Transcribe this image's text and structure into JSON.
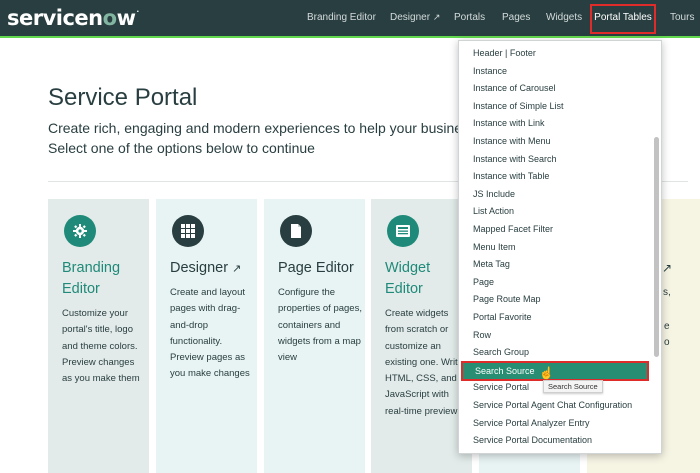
{
  "header": {
    "logo": {
      "text_before": "servicen",
      "o": "o",
      "text_after": "w",
      "tm": "."
    },
    "nav": [
      {
        "label": "Branding Editor"
      },
      {
        "label": "Designer"
      },
      {
        "label": "Portals"
      },
      {
        "label": "Pages"
      },
      {
        "label": "Widgets"
      },
      {
        "label": "Portal Tables"
      },
      {
        "label": "Tours"
      }
    ],
    "external_icon": "↗"
  },
  "hero": {
    "title": "Service Portal",
    "subtitle_line1": "Create rich, engaging and modern experiences to help your busine",
    "subtitle_line2": "Select one of the options below to continue"
  },
  "cards": [
    {
      "title": "Branding Editor",
      "icon": "gear-icon",
      "desc": "Customize your portal's title, logo and theme colors. Preview changes as you make them",
      "color_bg": "#e2ebe9",
      "color_icon": "#1f8a79",
      "color_title": "#1f8a79"
    },
    {
      "title": "Designer",
      "title_icon": "↗",
      "icon": "grid-icon",
      "desc": "Create and layout pages with drag-and-drop functionality. Preview pages as you make changes",
      "color_bg": "#e8f4f4",
      "color_icon": "#293e40",
      "color_title": "#293e40"
    },
    {
      "title": "Page Editor",
      "icon": "document-icon",
      "desc": "Configure the properties of pages, containers and widgets from a map view",
      "color_bg": "#e8f4f4",
      "color_icon": "#293e40",
      "color_title": "#293e40"
    },
    {
      "title": "Widget Editor",
      "icon": "widget-icon",
      "desc": "Create widgets from scratch or customize an existing one. Write HTML, CSS, and JavaScript with real-time preview",
      "color_bg": "#e2ebe9",
      "color_icon": "#1f8a79",
      "color_title": "#1f8a79"
    }
  ],
  "right_fragments": {
    "arrow": "↗",
    "s_comma": "s,",
    "e": "e",
    "o": "o"
  },
  "dropdown": {
    "items": [
      "Header | Footer",
      "Instance",
      "Instance of Carousel",
      "Instance of Simple List",
      "Instance with Link",
      "Instance with Menu",
      "Instance with Search",
      "Instance with Table",
      "JS Include",
      "List Action",
      "Mapped Facet Filter",
      "Menu Item",
      "Meta Tag",
      "Page",
      "Page Route Map",
      "Portal Favorite",
      "Row",
      "Search Group",
      "Search Source",
      "Service Portal",
      "Service Portal Agent Chat Configuration",
      "Service Portal Analyzer Entry",
      "Service Portal Documentation"
    ],
    "selected": "Search Source",
    "tooltip": "Search Source"
  }
}
